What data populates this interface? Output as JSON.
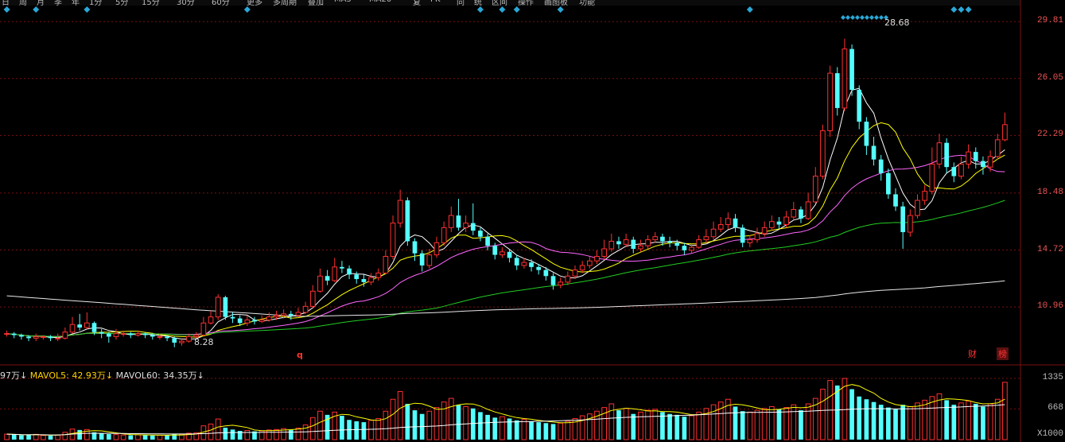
{
  "toolbar": {
    "tabs": [
      "日",
      "周",
      "月",
      "季",
      "年",
      "1分",
      "5分",
      "15分",
      "30分",
      "60分",
      "更多",
      "多周期",
      "叠加",
      "MA5",
      "MA20",
      "复",
      "PK",
      "同",
      "统",
      "区间",
      "操作",
      "画图板",
      "功能"
    ]
  },
  "price_axis": {
    "labels": [
      "29.81",
      "26.05",
      "22.29",
      "18.48",
      "14.72",
      "10.96"
    ]
  },
  "volume_axis": {
    "labels": [
      "1335",
      "668",
      "X1000"
    ]
  },
  "annotations": {
    "high": "28.68",
    "low": "8.28",
    "marker": "q",
    "badge_cai": "财",
    "badge_bang": "榜"
  },
  "volume_indicator": {
    "prefix": "97万↓",
    "mavol5": "MAVOL5: 42.93万↓",
    "mavol60": "MAVOL60: 34.35万↓"
  },
  "colors": {
    "up": "#ff3030",
    "down": "#54ffff",
    "ma5": "#ffffff",
    "ma10": "#ffff00",
    "ma20": "#ff66ff",
    "ma60": "#22cc22",
    "ma250": "#e8e8e8",
    "grid": "#7a1010"
  },
  "chart_data": {
    "type": "candlestick",
    "ylim": [
      7.5,
      30.5
    ],
    "candles": [
      [
        9.2,
        9.2,
        9.4,
        9.0
      ],
      [
        9.2,
        9.1,
        9.3,
        8.9
      ],
      [
        9.1,
        9.0,
        9.2,
        8.8
      ],
      [
        9.0,
        8.9,
        9.1,
        8.7
      ],
      [
        8.9,
        9.0,
        9.2,
        8.7
      ],
      [
        9.0,
        9.0,
        9.1,
        8.8
      ],
      [
        9.0,
        8.9,
        9.1,
        8.7
      ],
      [
        8.9,
        8.9,
        9.2,
        8.7
      ],
      [
        8.9,
        9.3,
        9.6,
        8.8
      ],
      [
        9.3,
        9.8,
        10.3,
        9.2
      ],
      [
        9.8,
        9.6,
        10.5,
        9.4
      ],
      [
        9.6,
        9.9,
        10.6,
        9.5
      ],
      [
        9.9,
        9.3,
        10.0,
        9.1
      ],
      [
        9.3,
        9.2,
        9.5,
        8.9
      ],
      [
        9.2,
        9.0,
        9.3,
        8.6
      ],
      [
        9.0,
        9.2,
        9.5,
        8.8
      ],
      [
        9.2,
        9.2,
        9.4,
        9.0
      ],
      [
        9.2,
        9.1,
        9.3,
        8.9
      ],
      [
        9.1,
        9.2,
        9.4,
        9.0
      ],
      [
        9.2,
        9.1,
        9.3,
        8.9
      ],
      [
        9.1,
        9.0,
        9.2,
        8.8
      ],
      [
        9.0,
        9.0,
        9.2,
        8.8
      ],
      [
        9.0,
        8.9,
        9.1,
        8.7
      ],
      [
        8.9,
        8.6,
        9.0,
        8.3
      ],
      [
        8.6,
        8.7,
        8.9,
        8.4
      ],
      [
        8.7,
        9.0,
        9.2,
        8.6
      ],
      [
        9.0,
        9.1,
        9.3,
        8.9
      ],
      [
        9.1,
        9.9,
        10.3,
        9.0
      ],
      [
        9.9,
        10.3,
        10.7,
        9.8
      ],
      [
        10.3,
        11.6,
        11.8,
        10.1
      ],
      [
        11.6,
        10.3,
        11.7,
        10.1
      ],
      [
        10.3,
        10.2,
        10.6,
        9.9
      ],
      [
        10.2,
        9.9,
        10.4,
        9.7
      ],
      [
        9.9,
        10.1,
        10.4,
        9.7
      ],
      [
        10.1,
        10.0,
        10.3,
        9.8
      ],
      [
        10.0,
        10.1,
        10.4,
        9.9
      ],
      [
        10.1,
        10.3,
        10.6,
        10.0
      ],
      [
        10.3,
        10.4,
        10.7,
        10.1
      ],
      [
        10.4,
        10.5,
        10.8,
        10.2
      ],
      [
        10.5,
        10.4,
        10.7,
        10.1
      ],
      [
        10.4,
        10.6,
        10.9,
        10.3
      ],
      [
        10.6,
        11.0,
        11.3,
        10.5
      ],
      [
        11.0,
        12.0,
        12.4,
        10.9
      ],
      [
        12.0,
        13.0,
        13.5,
        11.9
      ],
      [
        13.0,
        12.7,
        13.4,
        12.4
      ],
      [
        12.7,
        13.6,
        14.2,
        12.6
      ],
      [
        13.6,
        13.5,
        14.0,
        13.2
      ],
      [
        13.5,
        13.1,
        13.7,
        12.8
      ],
      [
        13.1,
        12.8,
        13.3,
        12.5
      ],
      [
        12.8,
        12.6,
        13.1,
        12.3
      ],
      [
        12.6,
        12.9,
        13.2,
        12.4
      ],
      [
        12.9,
        13.2,
        13.5,
        12.7
      ],
      [
        13.2,
        14.3,
        14.7,
        13.1
      ],
      [
        14.3,
        16.5,
        17.0,
        14.1
      ],
      [
        16.5,
        18.0,
        18.7,
        16.2
      ],
      [
        18.0,
        15.3,
        18.2,
        15.0
      ],
      [
        15.3,
        14.5,
        15.5,
        14.0
      ],
      [
        14.5,
        13.7,
        14.7,
        13.3
      ],
      [
        13.7,
        14.4,
        14.8,
        13.5
      ],
      [
        14.4,
        15.2,
        15.6,
        14.2
      ],
      [
        15.2,
        16.2,
        16.6,
        15.0
      ],
      [
        16.2,
        17.0,
        17.6,
        15.9
      ],
      [
        17.0,
        16.2,
        18.1,
        16.0
      ],
      [
        16.2,
        16.5,
        17.0,
        15.9
      ],
      [
        16.5,
        16.0,
        17.8,
        15.7
      ],
      [
        16.0,
        15.6,
        16.2,
        15.3
      ],
      [
        15.6,
        15.0,
        15.8,
        14.7
      ],
      [
        15.0,
        14.4,
        15.2,
        14.1
      ],
      [
        14.4,
        14.6,
        14.9,
        14.2
      ],
      [
        14.6,
        14.2,
        14.8,
        13.9
      ],
      [
        14.2,
        13.7,
        14.4,
        13.4
      ],
      [
        13.7,
        13.9,
        14.2,
        13.5
      ],
      [
        13.9,
        13.6,
        14.1,
        13.3
      ],
      [
        13.6,
        13.4,
        13.8,
        13.1
      ],
      [
        13.4,
        13.0,
        13.6,
        12.7
      ],
      [
        13.0,
        12.4,
        13.2,
        12.1
      ],
      [
        12.4,
        12.6,
        12.9,
        12.2
      ],
      [
        12.6,
        13.0,
        13.3,
        12.4
      ],
      [
        13.0,
        13.4,
        13.7,
        12.8
      ],
      [
        13.4,
        13.7,
        14.0,
        13.2
      ],
      [
        13.7,
        14.0,
        14.3,
        13.5
      ],
      [
        14.0,
        14.3,
        14.7,
        13.8
      ],
      [
        14.3,
        14.8,
        15.4,
        14.1
      ],
      [
        14.8,
        15.3,
        15.8,
        14.6
      ],
      [
        15.3,
        15.1,
        15.6,
        14.8
      ],
      [
        15.1,
        15.4,
        15.8,
        14.9
      ],
      [
        15.4,
        14.8,
        15.6,
        14.5
      ],
      [
        14.8,
        15.0,
        15.4,
        14.6
      ],
      [
        15.0,
        15.4,
        15.7,
        14.8
      ],
      [
        15.4,
        15.6,
        15.9,
        15.2
      ],
      [
        15.6,
        15.3,
        15.8,
        15.0
      ],
      [
        15.3,
        15.2,
        15.6,
        14.9
      ],
      [
        15.2,
        15.0,
        15.4,
        14.7
      ],
      [
        15.0,
        14.7,
        15.2,
        14.4
      ],
      [
        14.7,
        14.9,
        15.1,
        14.5
      ],
      [
        14.9,
        15.4,
        15.7,
        14.8
      ],
      [
        15.4,
        15.6,
        16.1,
        15.2
      ],
      [
        15.6,
        16.1,
        16.6,
        15.4
      ],
      [
        16.1,
        16.4,
        16.9,
        15.9
      ],
      [
        16.4,
        16.8,
        17.2,
        16.1
      ],
      [
        16.8,
        16.2,
        17.1,
        15.9
      ],
      [
        16.2,
        15.2,
        16.4,
        14.9
      ],
      [
        15.2,
        15.4,
        15.7,
        14.9
      ],
      [
        15.4,
        15.8,
        16.2,
        15.2
      ],
      [
        15.8,
        16.2,
        16.6,
        15.6
      ],
      [
        16.2,
        16.6,
        17.0,
        16.0
      ],
      [
        16.6,
        16.4,
        16.9,
        16.1
      ],
      [
        16.4,
        16.9,
        17.3,
        16.2
      ],
      [
        16.9,
        17.4,
        17.9,
        16.7
      ],
      [
        17.4,
        16.8,
        17.6,
        16.5
      ],
      [
        16.8,
        17.9,
        18.5,
        16.7
      ],
      [
        17.9,
        19.6,
        20.2,
        17.8
      ],
      [
        19.6,
        22.6,
        23.0,
        19.4
      ],
      [
        22.6,
        26.4,
        26.9,
        22.2
      ],
      [
        26.4,
        24.1,
        26.8,
        23.6
      ],
      [
        24.1,
        28.0,
        28.68,
        23.9
      ],
      [
        28.0,
        25.3,
        28.3,
        24.9
      ],
      [
        25.3,
        23.2,
        25.6,
        22.7
      ],
      [
        23.2,
        21.6,
        23.5,
        21.0
      ],
      [
        21.6,
        20.7,
        22.2,
        20.3
      ],
      [
        20.7,
        19.8,
        21.0,
        19.3
      ],
      [
        19.8,
        18.4,
        20.1,
        18.1
      ],
      [
        18.4,
        17.6,
        18.8,
        17.3
      ],
      [
        17.6,
        15.9,
        17.9,
        14.8
      ],
      [
        15.9,
        17.0,
        17.4,
        15.6
      ],
      [
        17.0,
        18.0,
        18.4,
        16.8
      ],
      [
        18.0,
        18.6,
        19.0,
        17.7
      ],
      [
        18.6,
        20.4,
        21.5,
        18.4
      ],
      [
        20.4,
        21.8,
        22.4,
        20.1
      ],
      [
        21.8,
        20.2,
        22.1,
        19.8
      ],
      [
        20.2,
        19.6,
        20.5,
        19.2
      ],
      [
        19.6,
        20.4,
        20.9,
        19.4
      ],
      [
        20.4,
        21.2,
        21.7,
        20.1
      ],
      [
        21.2,
        20.6,
        21.5,
        20.1
      ],
      [
        20.6,
        20.2,
        20.9,
        19.7
      ],
      [
        20.2,
        20.9,
        21.3,
        19.9
      ],
      [
        20.9,
        22.0,
        22.4,
        20.7
      ],
      [
        22.0,
        23.0,
        23.8,
        21.9
      ]
    ],
    "volumes": [
      120,
      110,
      95,
      100,
      115,
      90,
      85,
      100,
      160,
      230,
      210,
      220,
      160,
      130,
      120,
      110,
      100,
      95,
      105,
      100,
      90,
      95,
      90,
      120,
      110,
      140,
      150,
      300,
      340,
      450,
      260,
      220,
      190,
      200,
      180,
      190,
      210,
      220,
      240,
      220,
      250,
      320,
      480,
      620,
      540,
      600,
      520,
      430,
      400,
      380,
      420,
      460,
      620,
      880,
      1050,
      780,
      640,
      560,
      620,
      700,
      820,
      900,
      760,
      720,
      680,
      600,
      540,
      480,
      500,
      460,
      420,
      440,
      400,
      380,
      360,
      340,
      360,
      400,
      460,
      520,
      560,
      620,
      700,
      780,
      640,
      680,
      560,
      600,
      640,
      660,
      600,
      560,
      540,
      500,
      520,
      600,
      680,
      760,
      820,
      880,
      720,
      620,
      600,
      640,
      680,
      720,
      660,
      700,
      760,
      640,
      780,
      900,
      1100,
      1290,
      1180,
      1335,
      1100,
      940,
      880,
      820,
      760,
      700,
      660,
      760,
      720,
      800,
      860,
      940,
      1000,
      860,
      760,
      800,
      840,
      780,
      720,
      780,
      880,
      1250
    ]
  }
}
